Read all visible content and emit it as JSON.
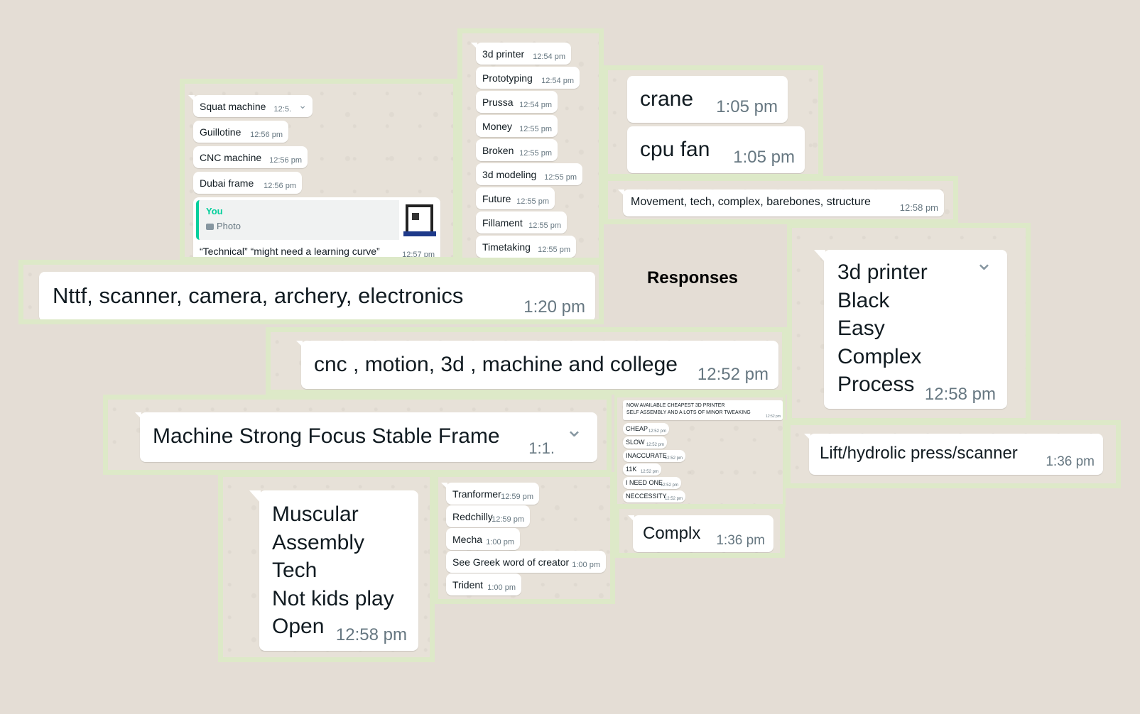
{
  "heading": "Responses",
  "panel_a": {
    "messages": [
      {
        "text": "Squat machine",
        "time": "12:5."
      },
      {
        "text": "Guillotine",
        "time": "12:56 pm"
      },
      {
        "text": "CNC machine",
        "time": "12:56 pm"
      },
      {
        "text": "Dubai frame",
        "time": "12:56 pm"
      }
    ],
    "reply": {
      "author": "You",
      "label": "Photo",
      "text": "“Technical” “might need a learning curve”",
      "time": "12:57 pm"
    }
  },
  "panel_b": {
    "messages": [
      {
        "text": "3d printer",
        "time": "12:54 pm"
      },
      {
        "text": "Prototyping",
        "time": "12:54 pm"
      },
      {
        "text": "Prussa",
        "time": "12:54 pm"
      },
      {
        "text": "Money",
        "time": "12:55 pm"
      },
      {
        "text": "Broken",
        "time": "12:55 pm"
      },
      {
        "text": "3d modeling",
        "time": "12:55 pm"
      },
      {
        "text": "Future",
        "time": "12:55 pm"
      },
      {
        "text": "Fillament",
        "time": "12:55 pm"
      },
      {
        "text": "Timetaking",
        "time": "12:55 pm"
      }
    ]
  },
  "panel_c": {
    "messages": [
      {
        "text": "crane",
        "time": "1:05 pm"
      },
      {
        "text": "cpu fan",
        "time": "1:05 pm"
      }
    ]
  },
  "panel_d": {
    "text": "Movement, tech, complex, barebones, structure",
    "time": "12:58 pm"
  },
  "panel_e": {
    "text": "Nttf, scanner, camera, archery, electronics",
    "time": "1:20 pm"
  },
  "panel_f": {
    "lines": [
      "3d printer",
      "Black",
      "Easy",
      "Complex",
      "Process"
    ],
    "time": "12:58 pm"
  },
  "panel_g": {
    "text": "cnc , motion, 3d , machine and college",
    "time": "12:52 pm"
  },
  "panel_h": {
    "text": "Machine Strong Focus Stable Frame",
    "time": "1:1."
  },
  "panel_i": {
    "header": {
      "line1": "NOW AVAILABLE CHEAPEST 3D PRINTER",
      "line2": "SELF ASSEMBLY AND A LOTS OF MINOR TWEAKING",
      "time": "12:52 pm"
    },
    "messages": [
      {
        "text": "CHEAP",
        "time": "12:52 pm"
      },
      {
        "text": "SLOW",
        "time": "12:52 pm"
      },
      {
        "text": "INACCURATE",
        "time": "12:52 pm"
      },
      {
        "text": "11K",
        "time": "12:52 pm"
      },
      {
        "text": "I NEED ONE",
        "time": "12:52 pm"
      },
      {
        "text": "NECCESSITY",
        "time": "12:52 pm"
      }
    ]
  },
  "panel_j": {
    "text": "Lift/hydrolic press/scanner",
    "time": "1:36 pm"
  },
  "panel_k": {
    "lines": [
      "Muscular",
      "Assembly",
      "Tech",
      "Not kids play",
      "Open"
    ],
    "time": "12:58 pm"
  },
  "panel_l": {
    "messages": [
      {
        "text": "Tranformer",
        "time": "12:59 pm"
      },
      {
        "text": "Redchilly",
        "time": "12:59 pm"
      },
      {
        "text": "Mecha",
        "time": "1:00 pm"
      },
      {
        "text": "See Greek word of creator",
        "time": "1:00 pm"
      },
      {
        "text": "Trident",
        "time": "1:00 pm"
      }
    ]
  },
  "panel_m": {
    "text": "Complx",
    "time": "1:36 pm"
  }
}
